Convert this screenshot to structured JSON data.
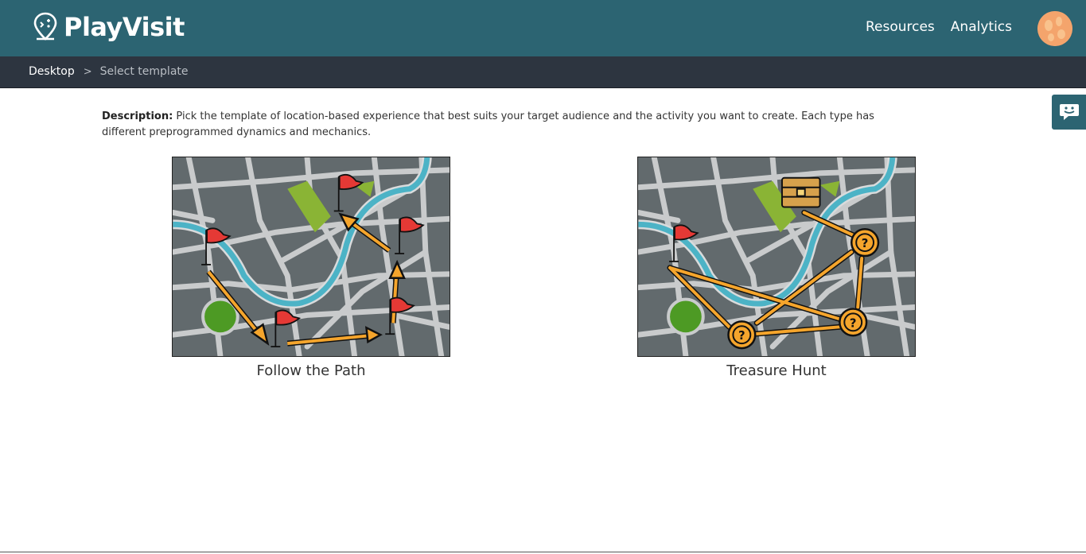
{
  "app": {
    "name": "PlayVisit"
  },
  "header": {
    "nav": [
      {
        "label": "Resources"
      },
      {
        "label": "Analytics"
      }
    ]
  },
  "breadcrumb": {
    "home": "Desktop",
    "separator": ">",
    "current": "Select template"
  },
  "description": {
    "label": "Description:",
    "text": "Pick the template of location-based experience that best suits your target audience and the activity you want to create. Each type has different preprogrammed dynamics and mechanics."
  },
  "templates": [
    {
      "title": "Follow the Path",
      "icon": "map-flags-arrows-illustration"
    },
    {
      "title": "Treasure Hunt",
      "icon": "map-treasure-chest-illustration"
    }
  ],
  "colors": {
    "header": "#2c6472",
    "breadcrumb_bar": "#2d3540",
    "map_bg": "#626a6d",
    "river": "#4cb3c6",
    "park": "#8ab435",
    "arrow": "#f5a52c",
    "flag": "#e53935"
  }
}
